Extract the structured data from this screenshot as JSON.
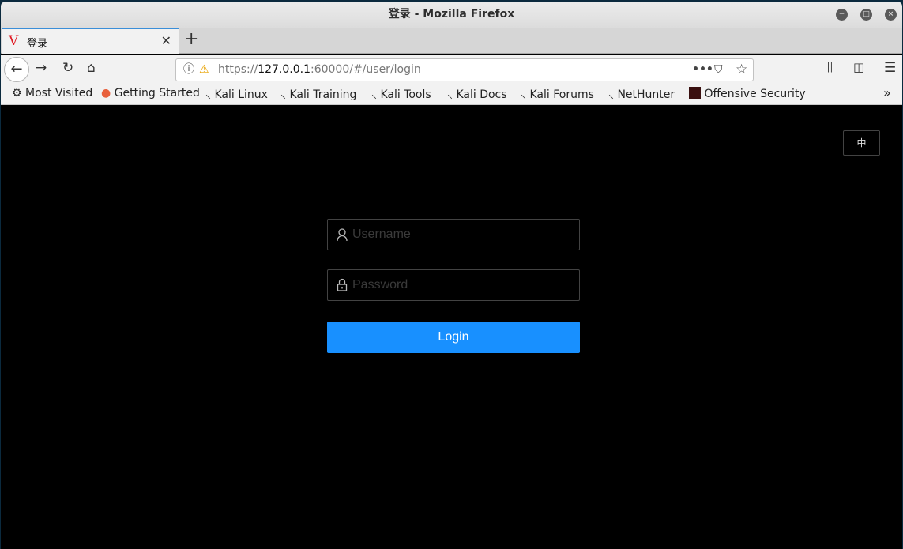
{
  "window": {
    "title": "登录 - Mozilla Firefox"
  },
  "tab": {
    "favicon": "V",
    "label": "登录"
  },
  "address": {
    "prefix": "https://",
    "host": "127.0.0.1",
    "rest": ":60000/#/user/login"
  },
  "bookmarks": [
    {
      "label": "Most Visited",
      "icon": "gear-icon"
    },
    {
      "label": "Getting Started",
      "icon": "firefox-icon"
    },
    {
      "label": "Kali Linux",
      "icon": "kali-dragon-icon"
    },
    {
      "label": "Kali Training",
      "icon": "kali-dragon-icon"
    },
    {
      "label": "Kali Tools",
      "icon": "kali-dragon-icon"
    },
    {
      "label": "Kali Docs",
      "icon": "kali-dragon-icon"
    },
    {
      "label": "Kali Forums",
      "icon": "kali-dragon-icon"
    },
    {
      "label": "NetHunter",
      "icon": "kali-dragon-icon"
    },
    {
      "label": "Offensive Security",
      "icon": "offsec-icon"
    }
  ],
  "page": {
    "language_toggle": "中",
    "username_placeholder": "Username",
    "password_placeholder": "Password",
    "login_label": "Login",
    "accent": "#1890ff"
  }
}
